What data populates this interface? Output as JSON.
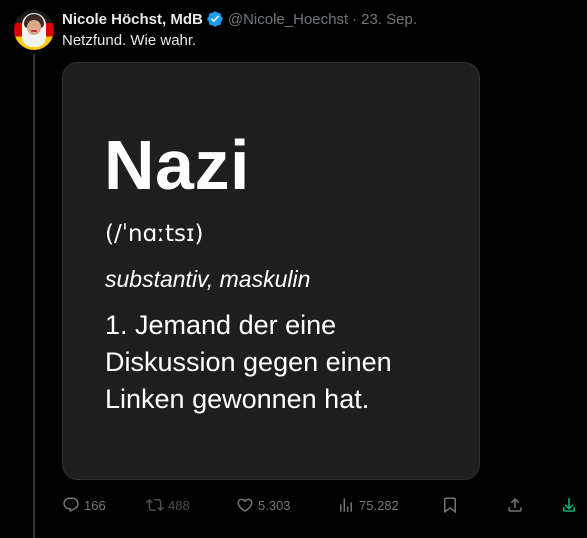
{
  "tweet": {
    "author_name": "Nicole Höchst, MdB",
    "handle": "@Nicole_Hoechst",
    "separator": "·",
    "date": "23. Sep.",
    "text": "Netzfund. Wie wahr."
  },
  "media": {
    "word": "Nazi",
    "pronunciation": "(/ˈnɑːtsɪ)",
    "part_of_speech": "substantiv, maskulin",
    "definition": "1. Jemand der eine Diskussion gegen einen Linken gewonnen hat."
  },
  "actions": {
    "replies": "166",
    "reposts": "488",
    "likes": "5.303",
    "views": "75.282"
  },
  "icons": {
    "verified": "verified-badge-icon",
    "reply": "reply-icon",
    "repost": "repost-icon",
    "like": "heart-icon",
    "views": "views-chart-icon",
    "bookmark": "bookmark-icon",
    "share": "share-icon",
    "download": "download-icon"
  },
  "colors": {
    "background": "#000000",
    "media_background": "#1e1e1e",
    "text_primary": "#e7e9ea",
    "text_secondary": "#71767b",
    "verified_blue": "#1d9bf0",
    "download_green": "#00ba7c"
  }
}
